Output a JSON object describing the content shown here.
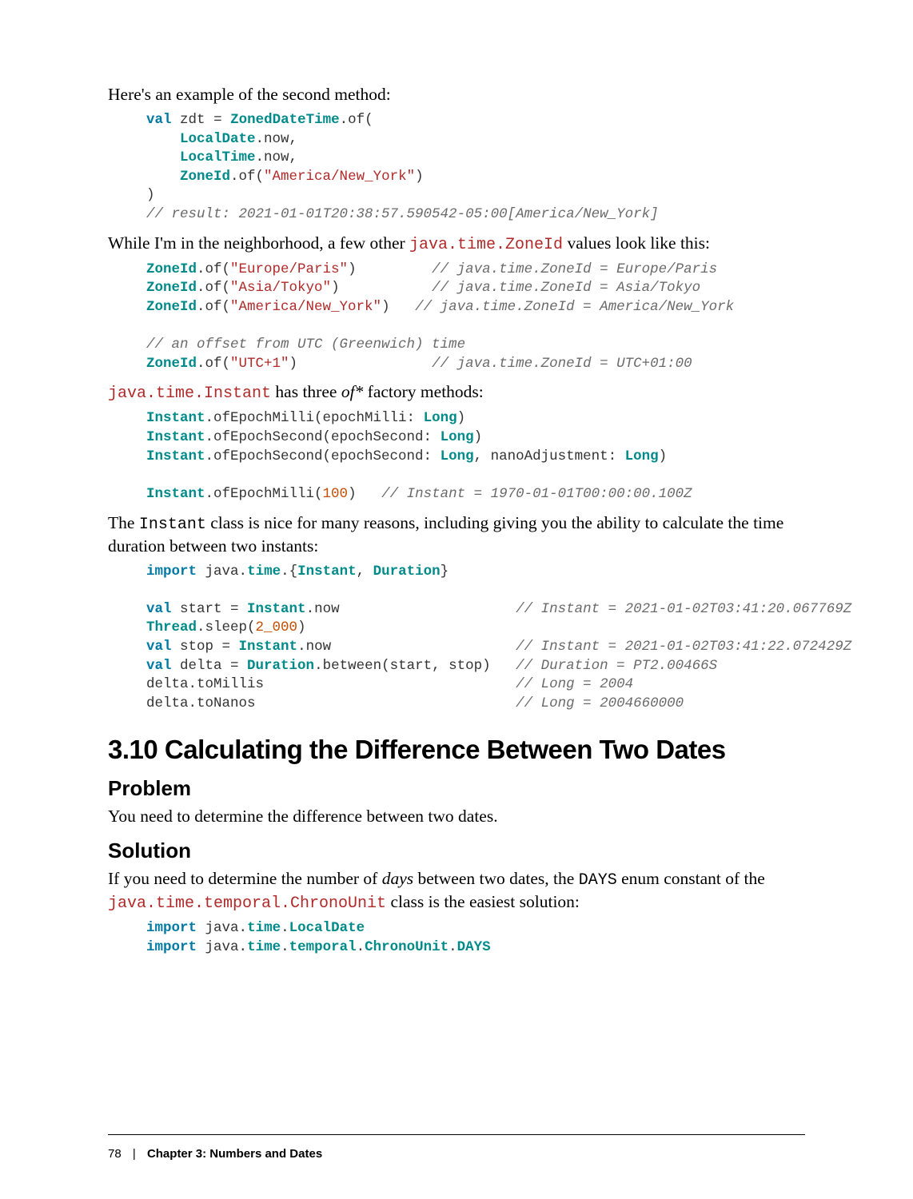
{
  "p1": "Here's an example of the second method:",
  "code1": "<span class='kw'>val</span> <span class='plain'>zdt</span> <span class='plain'>=</span> <span class='type'>ZonedDateTime</span><span class='plain'>.of(</span>\n    <span class='type'>LocalDate</span><span class='plain'>.now,</span>\n    <span class='type'>LocalTime</span><span class='plain'>.now,</span>\n    <span class='type'>ZoneId</span><span class='plain'>.of(</span><span class='str'>\"America/New_York\"</span><span class='plain'>)</span>\n<span class='plain'>)</span>\n<span class='com'>// result: 2021-01-01T20:38:57.590542-05:00[America/New_York]</span>",
  "p2_a": "While I'm in the neighborhood, a few other ",
  "p2_code": "java.time.ZoneId",
  "p2_b": " values look like this:",
  "code2": "<span class='type'>ZoneId</span><span class='plain'>.of(</span><span class='str'>\"Europe/Paris\"</span><span class='plain'>)</span>         <span class='com'>// java.time.ZoneId = Europe/Paris</span>\n<span class='type'>ZoneId</span><span class='plain'>.of(</span><span class='str'>\"Asia/Tokyo\"</span><span class='plain'>)</span>           <span class='com'>// java.time.ZoneId = Asia/Tokyo</span>\n<span class='type'>ZoneId</span><span class='plain'>.of(</span><span class='str'>\"America/New_York\"</span><span class='plain'>)</span>   <span class='com'>// java.time.ZoneId = America/New_York</span>\n\n<span class='com'>// an offset from UTC (Greenwich) time</span>\n<span class='type'>ZoneId</span><span class='plain'>.of(</span><span class='str'>\"UTC+1\"</span><span class='plain'>)</span>                <span class='com'>// java.time.ZoneId = UTC+01:00</span>",
  "p3_code": "java.time.Instant",
  "p3_a": " has three ",
  "p3_it": "of*",
  "p3_b": " factory methods:",
  "code3": "<span class='type'>Instant</span><span class='plain'>.ofEpochMilli(epochMilli: </span><span class='type'>Long</span><span class='plain'>)</span>\n<span class='type'>Instant</span><span class='plain'>.ofEpochSecond(epochSecond: </span><span class='type'>Long</span><span class='plain'>)</span>\n<span class='type'>Instant</span><span class='plain'>.ofEpochSecond(epochSecond: </span><span class='type'>Long</span><span class='plain'>, nanoAdjustment: </span><span class='type'>Long</span><span class='plain'>)</span>\n\n<span class='type'>Instant</span><span class='plain'>.ofEpochMilli(</span><span class='num'>100</span><span class='plain'>)</span>   <span class='com'>// Instant = 1970-01-01T00:00:00.100Z</span>",
  "p4_a": "The ",
  "p4_code": "Instant",
  "p4_b": " class is nice for many reasons, including giving you the ability to calculate the time duration between two instants:",
  "code4": "<span class='kw'>import</span> <span class='plain'>java</span><span class='plain'>.</span><span class='type'>time</span><span class='plain'>.{</span><span class='type'>Instant</span><span class='plain'>, </span><span class='type'>Duration</span><span class='plain'>}</span>\n\n<span class='kw'>val</span> <span class='plain'>start = </span><span class='type'>Instant</span><span class='plain'>.now</span>                     <span class='com'>// Instant = 2021-01-02T03:41:20.067769Z</span>\n<span class='type'>Thread</span><span class='plain'>.sleep(</span><span class='num'>2_000</span><span class='plain'>)</span>\n<span class='kw'>val</span> <span class='plain'>stop = </span><span class='type'>Instant</span><span class='plain'>.now</span>                      <span class='com'>// Instant = 2021-01-02T03:41:22.072429Z</span>\n<span class='kw'>val</span> <span class='plain'>delta = </span><span class='type'>Duration</span><span class='plain'>.between(start, stop)</span>   <span class='com'>// Duration = PT2.00466S</span>\n<span class='plain'>delta.toMillis</span>                              <span class='com'>// Long = 2004</span>\n<span class='plain'>delta.toNanos</span>                               <span class='com'>// Long = 2004660000</span>",
  "h1": "3.10 Calculating the Difference Between Two Dates",
  "h2a": "Problem",
  "p5": "You need to determine the difference between two dates.",
  "h2b": "Solution",
  "p6_a": "If you need to determine the number of ",
  "p6_it": "days",
  "p6_b": " between two dates, the ",
  "p6_code1": "DAYS",
  "p6_c": " enum constant of the ",
  "p6_code2": "java.time.temporal.ChronoUnit",
  "p6_d": " class is the easiest solution:",
  "code5": "<span class='kw'>import</span> <span class='plain'>java</span><span class='plain'>.</span><span class='type'>time</span><span class='plain'>.</span><span class='type'>LocalDate</span>\n<span class='kw'>import</span> <span class='plain'>java</span><span class='plain'>.</span><span class='type'>time</span><span class='plain'>.</span><span class='type'>temporal</span><span class='plain'>.</span><span class='type'>ChronoUnit</span><span class='plain'>.</span><span class='type'>DAYS</span>",
  "footer_pn": "78",
  "footer_sep": "|",
  "footer_chap": "Chapter 3: Numbers and Dates"
}
